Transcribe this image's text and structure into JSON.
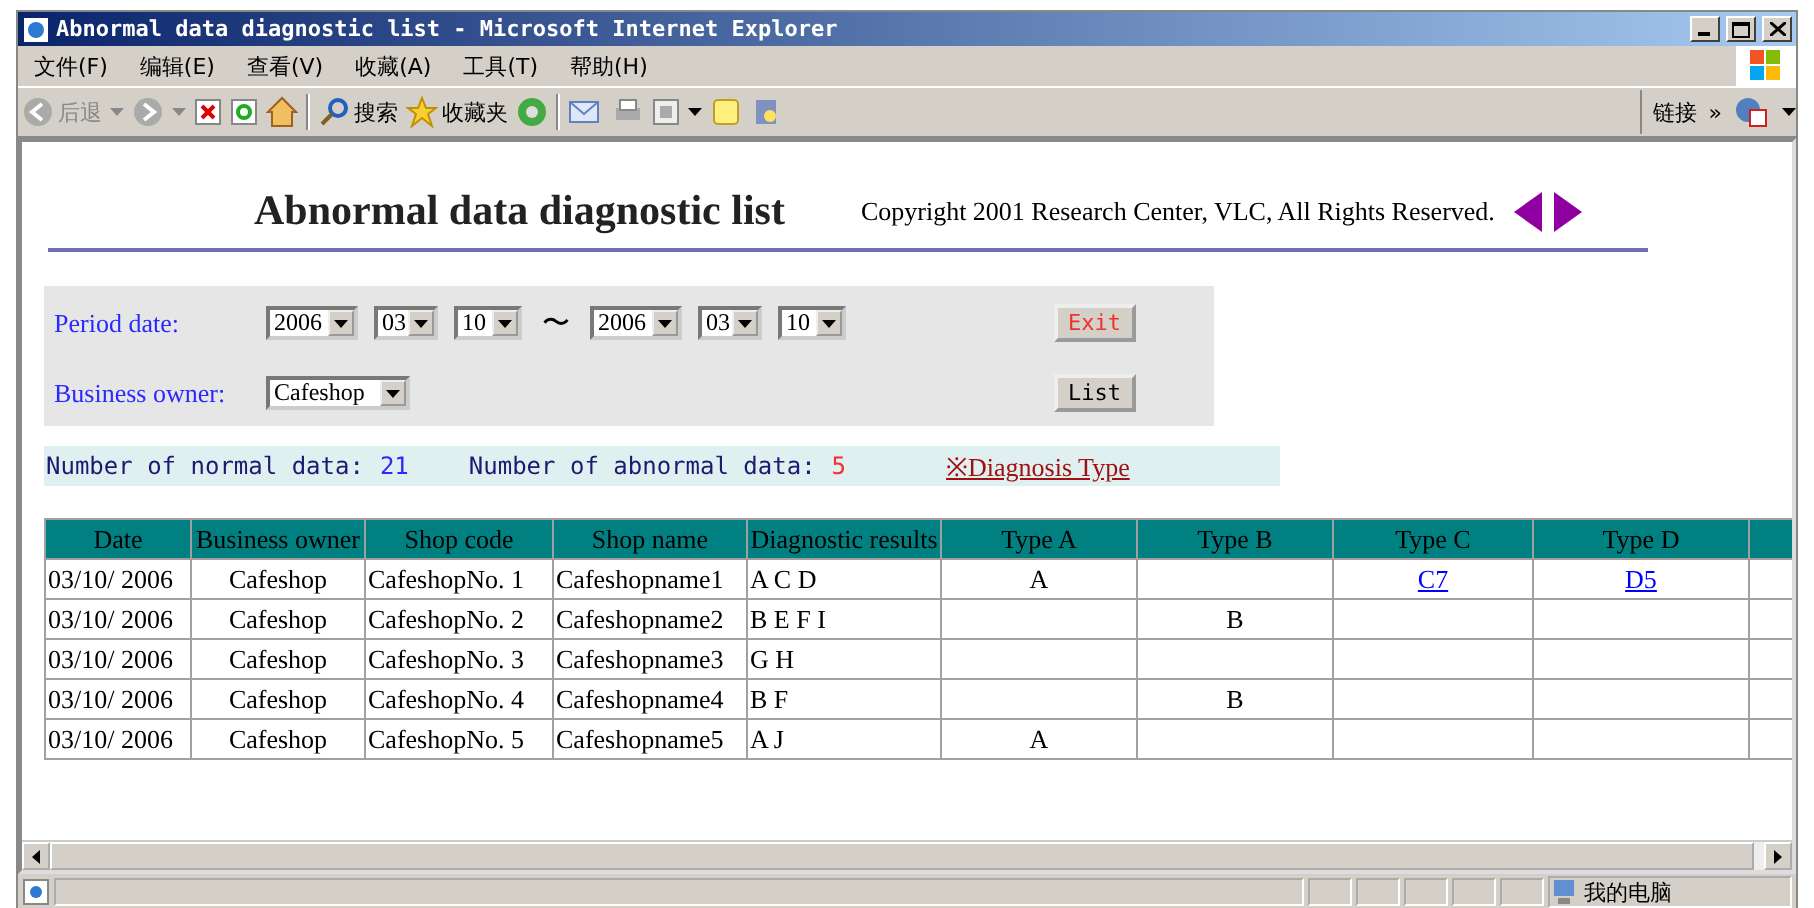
{
  "window": {
    "title": "Abnormal data diagnostic list - Microsoft Internet Explorer"
  },
  "menu": [
    "文件(F)",
    "编辑(E)",
    "查看(V)",
    "收藏(A)",
    "工具(T)",
    "帮助(H)"
  ],
  "toolbar": {
    "back": "后退",
    "search": "搜索",
    "favorites": "收藏夹",
    "links": "链接",
    "more": "»"
  },
  "page": {
    "heading": "Abnormal data diagnostic list",
    "copyright": "Copyright 2001 Research Center, VLC, All Rights Reserved.",
    "form": {
      "period_label": "Period date:",
      "from": [
        "2006",
        "03",
        "10"
      ],
      "separator": "〜",
      "to": [
        "2006",
        "03",
        "10"
      ],
      "owner_label": "Business owner:",
      "owner": "Cafeshop",
      "exit": "Exit",
      "list": "List"
    },
    "summary": {
      "normal_label": "Number of normal data:",
      "normal": "21",
      "abnormal_label": "Number of abnormal data:",
      "abnormal": "5",
      "link": "※Diagnosis Type"
    },
    "table": {
      "columns": [
        "Date",
        "Business owner",
        "Shop code",
        "Shop name",
        "Diagnostic results",
        "Type A",
        "Type B",
        "Type C",
        "Type D"
      ],
      "rows": [
        {
          "cells": [
            "03/10/ 2006",
            "Cafeshop",
            "CafeshopNo. 1",
            "Cafeshopname1",
            "A C D"
          ],
          "type_a": {
            "text": "A",
            "link": false
          },
          "type_c": {
            "text": "C7",
            "link": true
          },
          "type_d": {
            "text": "D5",
            "link": true
          }
        },
        {
          "cells": [
            "03/10/ 2006",
            "Cafeshop",
            "CafeshopNo. 2",
            "Cafeshopname2",
            "B E F I"
          ],
          "type_b": {
            "text": "B",
            "link": false
          }
        },
        {
          "cells": [
            "03/10/ 2006",
            "Cafeshop",
            "CafeshopNo. 3",
            "Cafeshopname3",
            "G H"
          ]
        },
        {
          "cells": [
            "03/10/ 2006",
            "Cafeshop",
            "CafeshopNo. 4",
            "Cafeshopname4",
            "B F"
          ],
          "type_b": {
            "text": "B",
            "link": false
          }
        },
        {
          "cells": [
            "03/10/ 2006",
            "Cafeshop",
            "CafeshopNo. 5",
            "Cafeshopname5",
            "A J"
          ],
          "type_a": {
            "text": "A",
            "link": false
          }
        }
      ]
    }
  },
  "status_bar": {
    "zone": "我的电脑"
  }
}
